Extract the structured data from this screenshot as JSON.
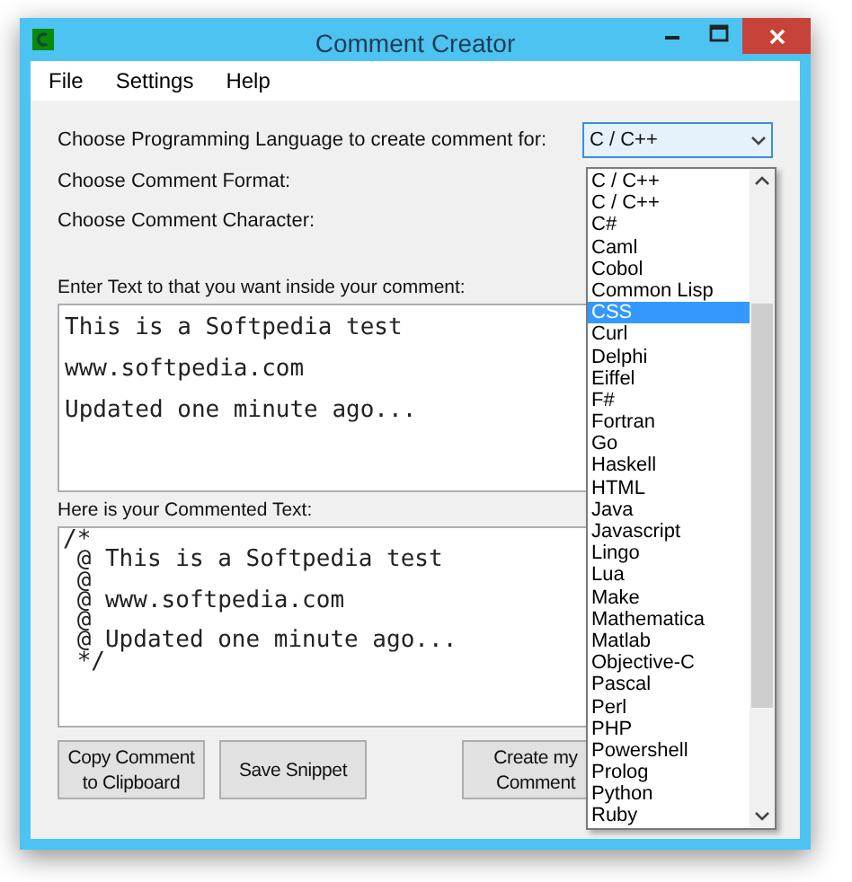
{
  "window": {
    "title": "Comment Creator"
  },
  "menu": [
    "File",
    "Settings",
    "Help"
  ],
  "form": {
    "language_label": "Choose Programming Language to create comment for:",
    "language_value": "C / C++",
    "format_label": "Choose Comment Format:",
    "character_label": "Choose Comment Character:"
  },
  "dropdown": {
    "items": [
      {
        "label": "C / C++",
        "selected": false
      },
      {
        "label": "C / C++",
        "selected": false
      },
      {
        "label": "C#",
        "selected": false
      },
      {
        "label": "Caml",
        "selected": false
      },
      {
        "label": "Cobol",
        "selected": false
      },
      {
        "label": "Common Lisp",
        "selected": false
      },
      {
        "label": "CSS",
        "selected": true
      },
      {
        "label": "Curl",
        "selected": false
      },
      {
        "label": "Delphi",
        "selected": false
      },
      {
        "label": "Eiffel",
        "selected": false
      },
      {
        "label": "F#",
        "selected": false
      },
      {
        "label": "Fortran",
        "selected": false
      },
      {
        "label": "Go",
        "selected": false
      },
      {
        "label": "Haskell",
        "selected": false
      },
      {
        "label": "HTML",
        "selected": false
      },
      {
        "label": "Java",
        "selected": false
      },
      {
        "label": "Javascript",
        "selected": false
      },
      {
        "label": "Lingo",
        "selected": false
      },
      {
        "label": "Lua",
        "selected": false
      },
      {
        "label": "Make",
        "selected": false
      },
      {
        "label": "Mathematica",
        "selected": false
      },
      {
        "label": "Matlab",
        "selected": false
      },
      {
        "label": "Objective-C",
        "selected": false
      },
      {
        "label": "Pascal",
        "selected": false
      },
      {
        "label": "Perl",
        "selected": false
      },
      {
        "label": "PHP",
        "selected": false
      },
      {
        "label": "Powershell",
        "selected": false
      },
      {
        "label": "Prolog",
        "selected": false
      },
      {
        "label": "Python",
        "selected": false
      },
      {
        "label": "Ruby",
        "selected": false
      }
    ]
  },
  "input": {
    "label": "Enter Text to that you want inside your comment:",
    "lines": [
      "This is a Softpedia test",
      "www.softpedia.com",
      "Updated one minute ago..."
    ]
  },
  "output": {
    "label": "Here is your Commented Text:",
    "lines": [
      "/*",
      " @ This is a Softpedia test",
      " @",
      " @ www.softpedia.com",
      " @",
      " @ Updated one minute ago...",
      " */"
    ]
  },
  "buttons": [
    "Copy Comment to Clipboard",
    "Save Snippet",
    "Create my Comment"
  ]
}
